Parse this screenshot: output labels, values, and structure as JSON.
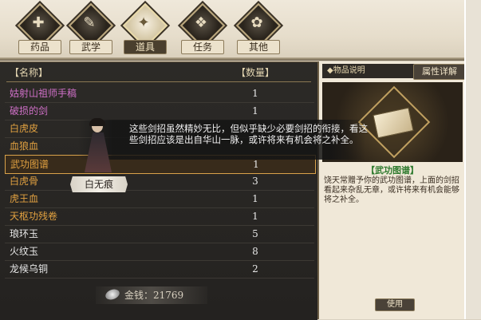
{
  "tabs": [
    {
      "label": "药品",
      "glyph": "✚"
    },
    {
      "label": "武学",
      "glyph": "✎"
    },
    {
      "label": "道具",
      "glyph": "✦"
    },
    {
      "label": "任务",
      "glyph": "❖"
    },
    {
      "label": "其他",
      "glyph": "✿"
    }
  ],
  "active_tab": "道具",
  "inventory": {
    "header_name": "【名称】",
    "header_qty": "【数量】",
    "items": [
      {
        "name": "姑射山祖师手稿",
        "qty": "1",
        "color": "#d070c8"
      },
      {
        "name": "破损的剑",
        "qty": "1",
        "color": "#d070c8"
      },
      {
        "name": "白虎皮",
        "qty": "1",
        "color": "#e0a040"
      },
      {
        "name": "血狼血",
        "qty": "",
        "color": "#e0a040"
      },
      {
        "name": "武功图谱",
        "qty": "1",
        "color": "#e0a040"
      },
      {
        "name": "白虎骨",
        "qty": "3",
        "color": "#e0a040"
      },
      {
        "name": "虎王血",
        "qty": "1",
        "color": "#e0a040"
      },
      {
        "name": "天枢功残卷",
        "qty": "1",
        "color": "#e0a040"
      },
      {
        "name": "琅环玉",
        "qty": "5",
        "color": "#e8e8e8"
      },
      {
        "name": "火纹玉",
        "qty": "8",
        "color": "#e8e8e8"
      },
      {
        "name": "龙候乌铜",
        "qty": "2",
        "color": "#e8e8e8"
      }
    ],
    "selected_index": 4
  },
  "money": {
    "label": "金钱：21769"
  },
  "detail": {
    "title": "◆物品说明",
    "attr_tab": "属性详解",
    "item_name": "【武功图谱】",
    "description": "饶天常赠予你的武功图谱，上面的剑招看起来杂乱无章，或许将来有机会能够将之补全。",
    "use_button": "使用"
  },
  "dialogue": {
    "speaker": "白无痕",
    "text": "这些剑招虽然精妙无比，但似乎缺少必要剑招的衔接，看这些剑招应该是出自华山一脉，或许将来有机会将之补全。"
  }
}
